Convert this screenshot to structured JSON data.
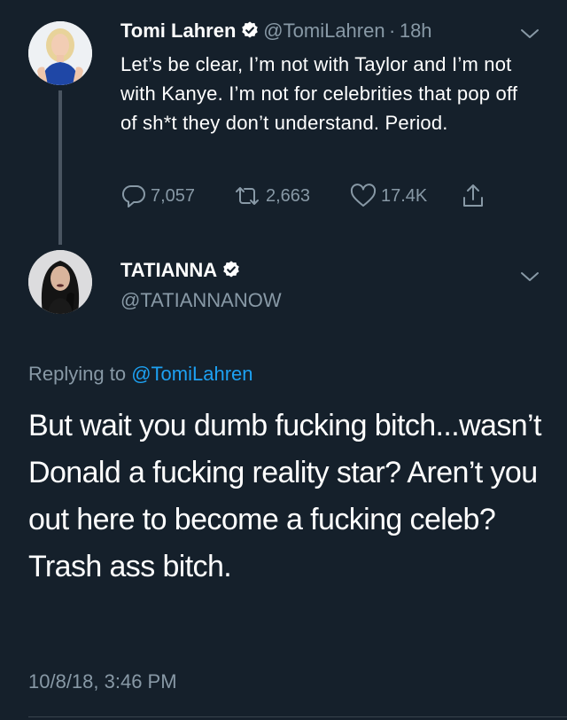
{
  "colors": {
    "background": "#15202b",
    "primary_text": "#ffffff",
    "secondary_text": "#8899a6",
    "link": "#1da1f2",
    "thread_line": "#4a5561"
  },
  "parent_tweet": {
    "author_name": "Tomi Lahren",
    "author_handle": "@TomiLahren",
    "separator": "·",
    "time_ago": "18h",
    "verified": true,
    "text": "Let’s be clear, I’m not with Taylor and I’m not with Kanye. I’m not for celebrities that pop off of sh*t they don’t understand. Period.",
    "actions": {
      "reply_count": "7,057",
      "retweet_count": "2,663",
      "like_count": "17.4K",
      "icons": [
        "reply-icon",
        "retweet-icon",
        "like-icon",
        "share-icon"
      ]
    }
  },
  "reply_tweet": {
    "author_name": "TATIANNA",
    "author_handle": "@TATIANNANOW",
    "verified": true,
    "replying_to_prefix": "Replying to",
    "replying_to_user": "@TomiLahren",
    "text": "But wait you dumb fucking bitch...wasn’t Donald a fucking reality star? Aren’t you out here to become a fucking celeb? Trash ass bitch.",
    "timestamp": "10/8/18, 3:46 PM"
  }
}
